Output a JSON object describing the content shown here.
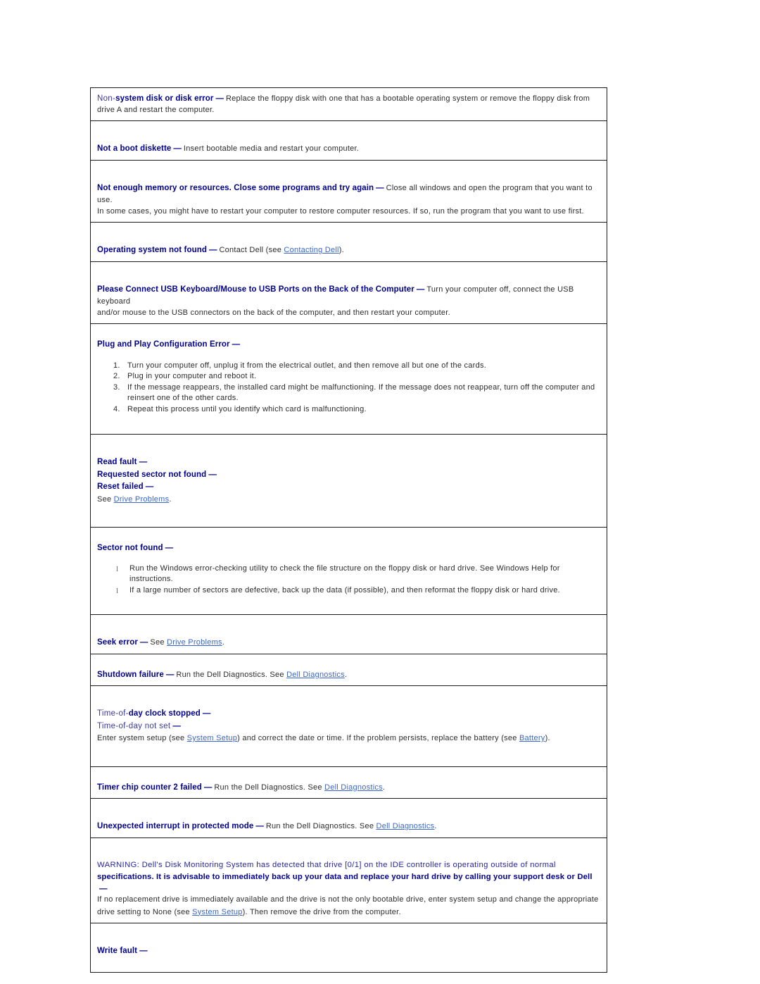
{
  "document": {
    "type": "error-messages-reference",
    "link_color": "#3a66cc",
    "heading_color": "#00008f",
    "body_color": "#2b2b2b",
    "dash": "—",
    "bullet_glyph": "l"
  },
  "blocks": [
    {
      "id": "non-system-disk",
      "heading_prefix": "Non-",
      "heading": "system disk or disk error",
      "body_1": "Replace the floppy disk with one that has a bootable operating system or remove the floppy disk from",
      "body_2": "drive A and restart the computer."
    },
    {
      "id": "not-a-boot-diskette",
      "heading": "Not a boot diskette",
      "body_1": "Insert bootable media and restart your computer."
    },
    {
      "id": "not-enough-memory",
      "heading": "Not enough memory or resources. Close some programs and try again",
      "body_1": "Close all windows and open the program that you want to use.",
      "body_2": "In some cases, you might have to restart your computer to restore computer resources. If so, run the program that you want to use first."
    },
    {
      "id": "operating-system-not-found",
      "heading": "Operating system not found",
      "body_1": "Contact Dell (see ",
      "link_1": "Contacting Dell",
      "body_2": ")."
    },
    {
      "id": "please-connect-usb",
      "heading": "Please Connect USB Keyboard/Mouse to USB Ports on the Back of the Computer",
      "body_1": "Turn your computer off, connect the USB keyboard",
      "body_2": "and/or mouse to the USB connectors on the back of the computer, and then restart your computer."
    },
    {
      "id": "plug-and-play-config-error",
      "heading": "Plug and Play Configuration Error",
      "steps": [
        "Turn your computer off, unplug it from the electrical outlet, and then remove all but one of the cards.",
        "Plug in your computer and reboot it.",
        "If the message reappears, the installed card might be malfunctioning. If the message does not reappear, turn off the computer and reinsert one of the other cards.",
        "Repeat this process until you identify which card is malfunctioning."
      ]
    },
    {
      "id": "read-fault-group",
      "heading_1": "Read fault",
      "heading_2": "Requested sector not found",
      "heading_3": "Reset failed",
      "see_text": "See ",
      "see_link": "Drive Problems",
      "see_tail": "."
    },
    {
      "id": "sector-not-found",
      "heading": "Sector not found",
      "bullets": [
        "Run the Windows error-checking utility to check the file structure on the floppy disk or hard drive. See Windows Help for instructions.",
        "If a large number of sectors are defective, back up the data (if possible), and then reformat the floppy disk or hard drive."
      ]
    },
    {
      "id": "seek-error",
      "heading": "Seek error",
      "body_1": "See ",
      "link_1": "Drive Problems",
      "body_2": "."
    },
    {
      "id": "shutdown-failure",
      "heading": "Shutdown failure",
      "body_1": "Run the Dell Diagnostics. See ",
      "link_1": "Dell Diagnostics",
      "body_2": "."
    },
    {
      "id": "time-of-day-group",
      "heading_1_prefix": "Time-of-",
      "heading_1": "day clock stopped",
      "heading_2": "Time-of-day not set",
      "body_1": "Enter system setup (see ",
      "link_1": "System Setup",
      "body_2": ") and correct the date or time. If the problem persists, replace the battery (see ",
      "link_2": "Battery",
      "body_3": ")."
    },
    {
      "id": "timer-chip-counter-2-failed",
      "heading": "Timer chip counter 2 failed",
      "body_1": "Run the Dell Diagnostics. See ",
      "link_1": "Dell Diagnostics",
      "body_2": "."
    },
    {
      "id": "unexpected-interrupt",
      "heading": "Unexpected interrupt in protected mode",
      "body_1": "Run the Dell Diagnostics. See ",
      "link_1": "Dell Diagnostics",
      "body_2": "."
    },
    {
      "id": "warning-disk-monitoring",
      "warn_line_1": "WARNING: Dell's Disk Monitoring System has detected that drive [0/1] on the IDE controller is operating outside of normal",
      "warn_line_2": "specifications. It is advisable to immediately back up your data and replace your hard drive by calling your support desk or Dell",
      "body_1": " If no replacement drive is immediately available and the drive is not the only bootable drive, enter system setup and change the appropriate",
      "body_2": "drive setting to None (see ",
      "link_1": "System Setup",
      "body_3": "). Then remove the drive from the computer."
    },
    {
      "id": "write-fault",
      "heading": "Write fault"
    }
  ]
}
